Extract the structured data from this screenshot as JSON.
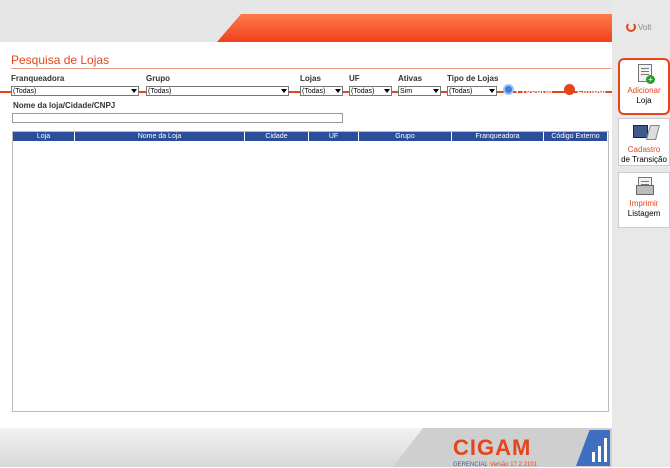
{
  "header": {
    "back_label": "Volt"
  },
  "page": {
    "title": "Pesquisa de Lojas"
  },
  "filters": {
    "franqueadora": {
      "label": "Franqueadora",
      "value": "(Todas)"
    },
    "grupo": {
      "label": "Grupo",
      "value": "(Todas)"
    },
    "lojas": {
      "label": "Lojas",
      "value": "(Todas)"
    },
    "uf": {
      "label": "UF",
      "value": "(Todas)"
    },
    "ativas": {
      "label": "Ativas",
      "value": "Sim"
    },
    "tipo": {
      "label": "Tipo de Lojas",
      "value": "(Todas)"
    },
    "search_label": "Procurar",
    "clear_label": "Limpar",
    "name_label": "Nome da loja/Cidade/CNPJ",
    "name_value": ""
  },
  "table": {
    "columns": [
      "Loja",
      "Nome da Loja",
      "Cidade",
      "UF",
      "Grupo",
      "Franqueadora",
      "Código Externo"
    ],
    "rows": []
  },
  "side": {
    "add": {
      "line1": "Adicionar",
      "line2": "Loja"
    },
    "cadastro": {
      "line1": "Cadastro",
      "line2": "de Transição"
    },
    "imprimir": {
      "line1": "Imprimir",
      "line2": "Listagem"
    }
  },
  "footer": {
    "brand": "CIGAM",
    "product": "GERENCIAL",
    "version": "Versão 17.2.2101"
  },
  "colors": {
    "accent": "#e4451b",
    "header_blue": "#2a4e9c"
  }
}
